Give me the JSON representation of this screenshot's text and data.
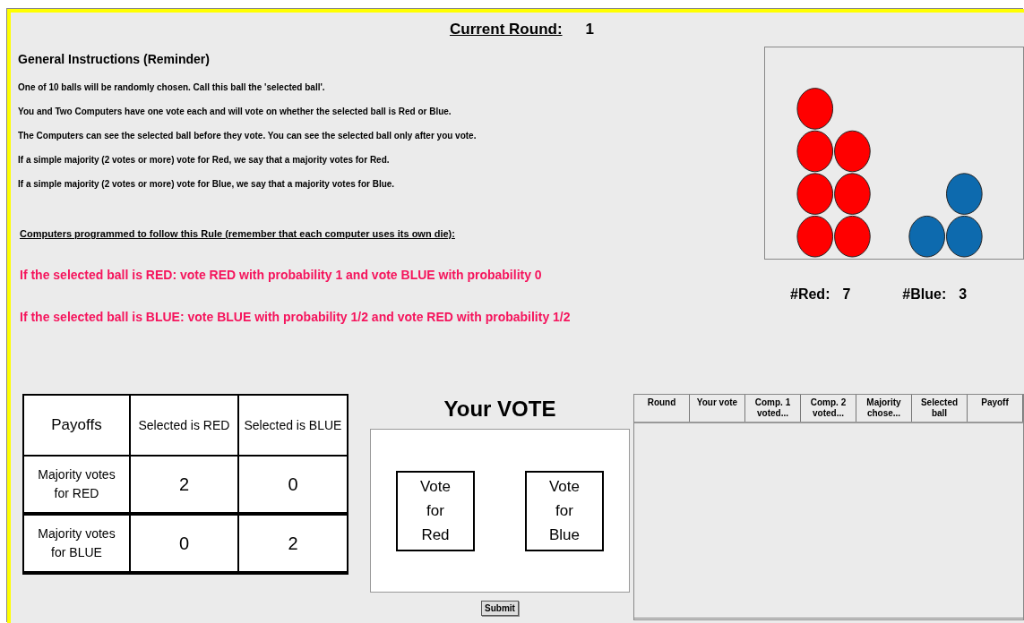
{
  "current_round": {
    "label": "Current Round:",
    "value": "1"
  },
  "instructions": {
    "title": "General Instructions (Reminder)",
    "lines": [
      "One of 10 balls will be randomly chosen. Call this ball the 'selected ball'.",
      "You and Two Computers have one vote each and will vote on whether the selected ball is Red or Blue.",
      "The Computers can see the selected ball before they vote. You can see the selected ball only after you vote.",
      "If a simple majority (2 votes or more) vote for Red, we say that a majority votes for Red.",
      "If a simple majority (2 votes or more) vote for Blue, we say that a majority votes for Blue."
    ],
    "rule_heading": "Computers programmed to follow this Rule (remember that each computer uses its own die):",
    "rules": [
      "If the selected ball is RED: vote RED with probability 1 and vote BLUE with probability 0",
      "If the selected ball is BLUE: vote BLUE with probability 1/2 and vote RED with probability 1/2"
    ]
  },
  "urn": {
    "groups": [
      {
        "columns": [
          [
            {
              "color": "#ff0000"
            },
            {
              "color": "#ff0000"
            },
            {
              "color": "#ff0000"
            },
            {
              "color": "#ff0000"
            }
          ],
          [
            {
              "color": "#ff0000"
            },
            {
              "color": "#ff0000"
            },
            {
              "color": "#ff0000"
            }
          ]
        ]
      },
      {
        "columns": [
          [
            {
              "color": "#0d6aae"
            }
          ],
          [
            {
              "color": "#0d6aae"
            },
            {
              "color": "#0d6aae"
            }
          ]
        ]
      }
    ]
  },
  "counts": [
    {
      "label": "#Red:",
      "value": "7"
    },
    {
      "label": "#Blue:",
      "value": "3"
    }
  ],
  "payoffs": {
    "columns": [
      "Payoffs",
      "Selected is RED",
      "Selected is BLUE"
    ],
    "rows": [
      {
        "label": "Majority votes for RED",
        "values": [
          "2",
          "0"
        ]
      },
      {
        "label": "Majority votes for BLUE",
        "values": [
          "0",
          "2"
        ]
      }
    ]
  },
  "vote": {
    "title": "Your VOTE",
    "options": [
      "Vote for Red",
      "Vote for Blue"
    ],
    "submit": "Submit"
  },
  "history": {
    "columns": [
      "Round",
      "Your vote",
      "Comp. 1 voted...",
      "Comp. 2 voted...",
      "Majority chose...",
      "Selected ball",
      "Payoff"
    ]
  }
}
